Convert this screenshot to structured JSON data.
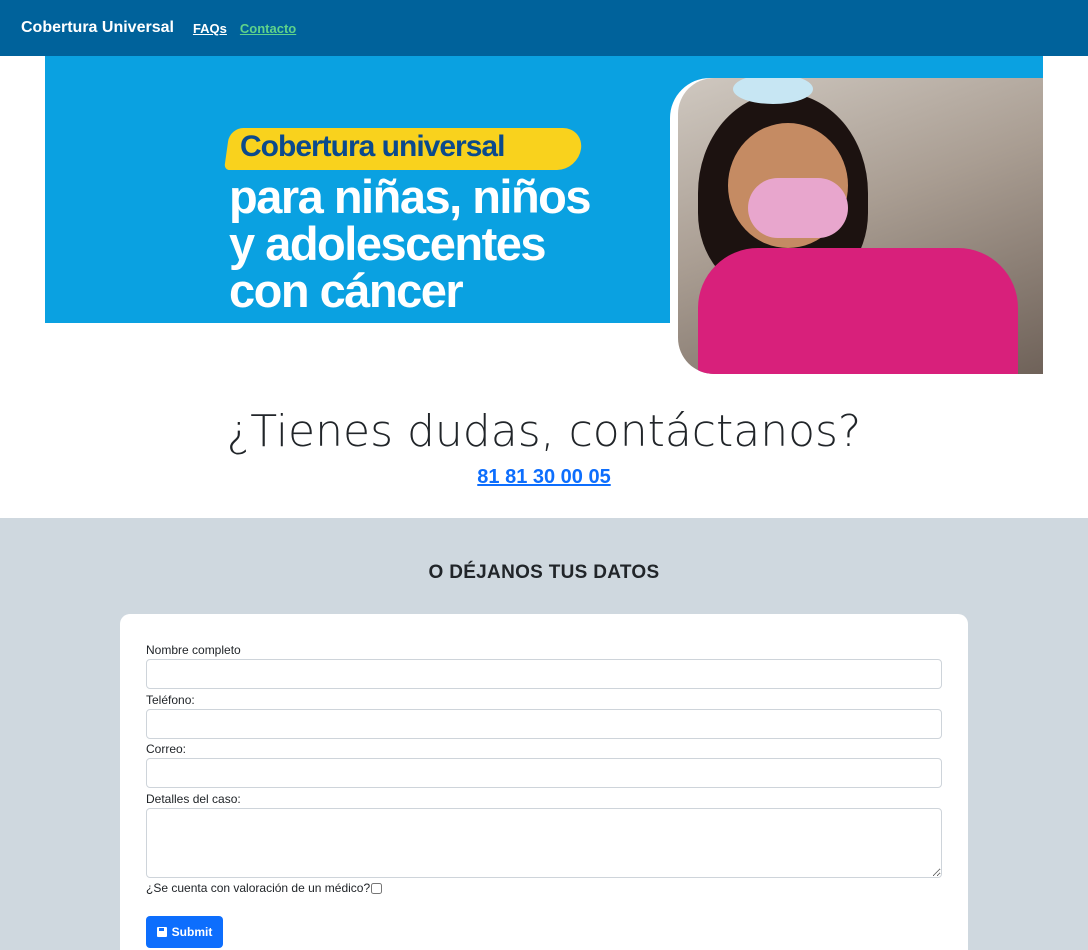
{
  "navbar": {
    "brand": "Cobertura Universal",
    "links": [
      {
        "label": "FAQs"
      },
      {
        "label": "Contacto"
      }
    ]
  },
  "banner": {
    "pill_text": "Cobertura universal",
    "lines": [
      "para niñas, niños",
      "y adolescentes",
      "con cáncer"
    ]
  },
  "contact": {
    "title": "¿Tienes dudas, contáctanos?",
    "phone": "81 81 30 00 05"
  },
  "form": {
    "heading": "O DÉJANOS TUS DATOS",
    "fields": [
      {
        "label": "Nombre completo",
        "value": ""
      },
      {
        "label": "Teléfono:",
        "value": ""
      },
      {
        "label": "Correo:",
        "value": ""
      },
      {
        "label": "Detalles del caso:",
        "value": ""
      }
    ],
    "checkbox_label": "¿Se cuenta con valoración de un médico?",
    "checkbox_checked": false,
    "submit_label": "Submit",
    "submit_icon": "save-icon"
  },
  "colors": {
    "navbar": "#00629b",
    "banner": "#0aa1e1",
    "pill": "#f9d21d",
    "section_bg": "#cfd8df",
    "primary": "#0d6efd",
    "contacto_link": "#5fd38a"
  }
}
